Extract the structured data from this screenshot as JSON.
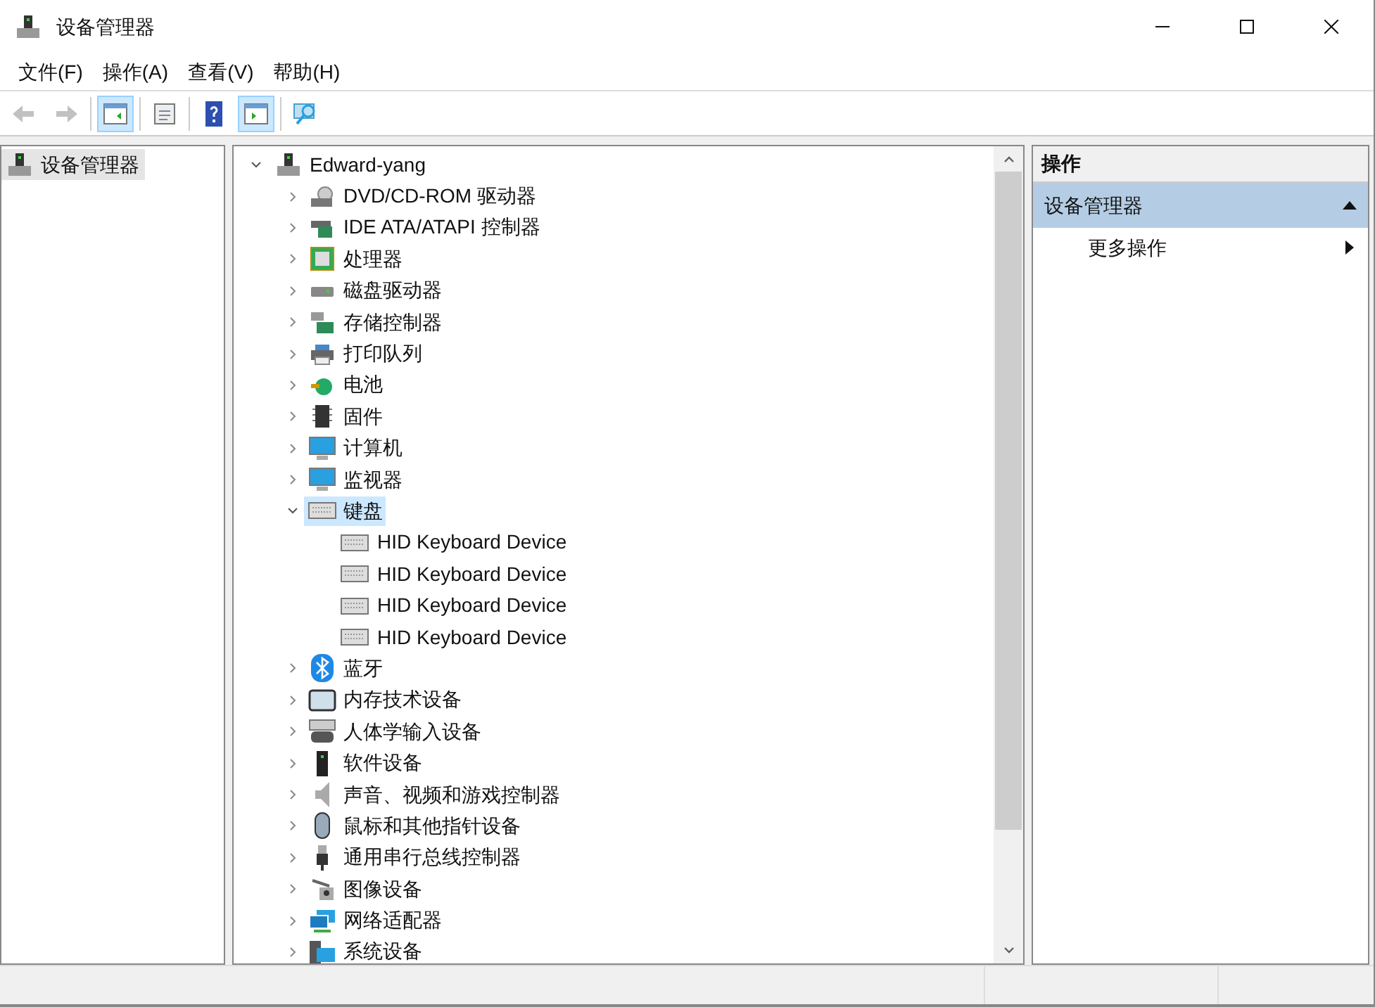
{
  "window": {
    "title": "设备管理器"
  },
  "menu": [
    "文件(F)",
    "操作(A)",
    "查看(V)",
    "帮助(H)"
  ],
  "toolbar": [
    {
      "kind": "back",
      "disabled": true,
      "pressed": false
    },
    {
      "kind": "forward",
      "disabled": true,
      "pressed": false
    },
    {
      "kind": "tree-pane",
      "disabled": false,
      "pressed": true
    },
    {
      "kind": "properties",
      "disabled": false,
      "pressed": false
    },
    {
      "kind": "help",
      "disabled": false,
      "pressed": false
    },
    {
      "kind": "action-pane",
      "disabled": false,
      "pressed": true
    },
    {
      "kind": "scan",
      "disabled": false,
      "pressed": false
    }
  ],
  "console_tree": {
    "items": [
      {
        "label": "设备管理器",
        "selected": false
      }
    ]
  },
  "device_tree": {
    "label": "Edward-yang",
    "expanded": true,
    "children": [
      {
        "label": "DVD/CD-ROM 驱动器",
        "expanded": false,
        "selected": false
      },
      {
        "label": "IDE ATA/ATAPI 控制器",
        "expanded": false,
        "selected": false
      },
      {
        "label": "处理器",
        "expanded": false,
        "selected": false
      },
      {
        "label": "磁盘驱动器",
        "expanded": false,
        "selected": false
      },
      {
        "label": "存储控制器",
        "expanded": false,
        "selected": false
      },
      {
        "label": "打印队列",
        "expanded": false,
        "selected": false
      },
      {
        "label": "电池",
        "expanded": false,
        "selected": false
      },
      {
        "label": "固件",
        "expanded": false,
        "selected": false
      },
      {
        "label": "计算机",
        "expanded": false,
        "selected": false
      },
      {
        "label": "监视器",
        "expanded": false,
        "selected": false
      },
      {
        "label": "键盘",
        "expanded": true,
        "selected": true,
        "children": [
          {
            "label": "HID Keyboard Device",
            "selected": false
          },
          {
            "label": "HID Keyboard Device",
            "selected": false
          },
          {
            "label": "HID Keyboard Device",
            "selected": false
          },
          {
            "label": "HID Keyboard Device",
            "selected": false
          }
        ]
      },
      {
        "label": "蓝牙",
        "expanded": false,
        "selected": false
      },
      {
        "label": "内存技术设备",
        "expanded": false,
        "selected": false
      },
      {
        "label": "人体学输入设备",
        "expanded": false,
        "selected": false
      },
      {
        "label": "软件设备",
        "expanded": false,
        "selected": false
      },
      {
        "label": "声音、视频和游戏控制器",
        "expanded": false,
        "selected": false
      },
      {
        "label": "鼠标和其他指针设备",
        "expanded": false,
        "selected": false
      },
      {
        "label": "通用串行总线控制器",
        "expanded": false,
        "selected": false
      },
      {
        "label": "图像设备",
        "expanded": false,
        "selected": false
      },
      {
        "label": "网络适配器",
        "expanded": false,
        "selected": false
      },
      {
        "label": "系统设备",
        "expanded": false,
        "selected": false
      }
    ]
  },
  "actions_pane": {
    "title": "操作",
    "section": {
      "label": "设备管理器",
      "expanded": true
    },
    "items": [
      "更多操作"
    ]
  }
}
